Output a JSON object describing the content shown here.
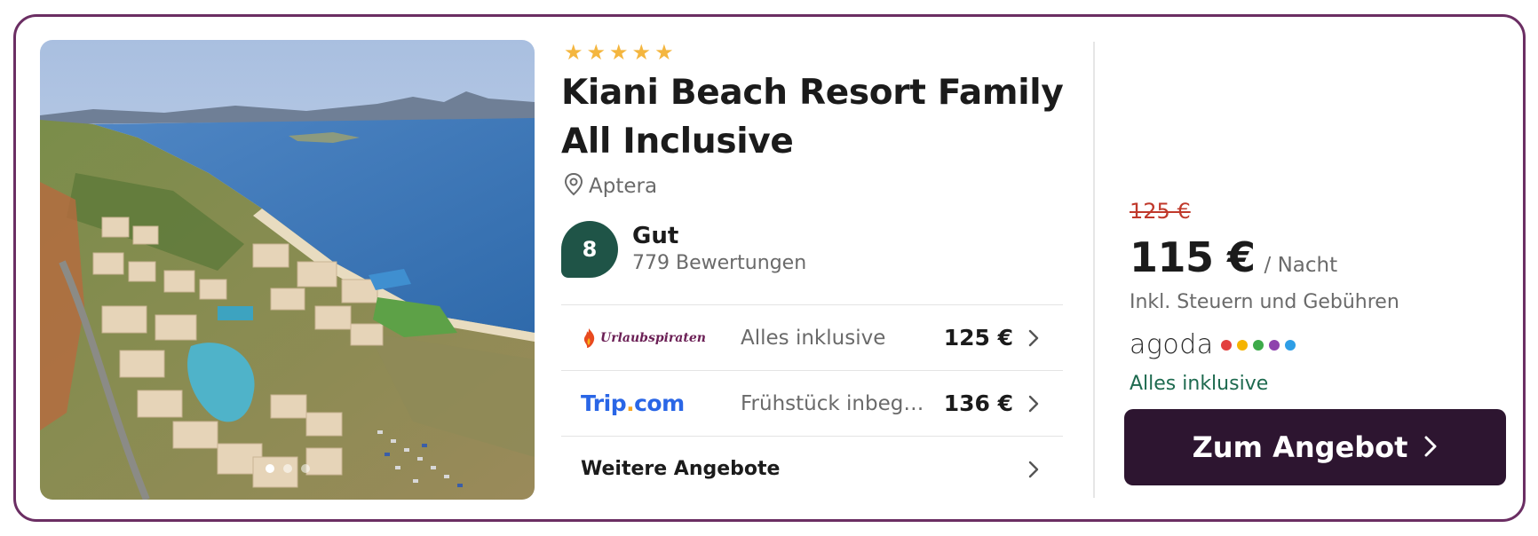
{
  "hotel": {
    "stars": 5,
    "name": "Kiani Beach Resort Family All Inclusive",
    "location": "Aptera",
    "rating": {
      "score": "8",
      "label": "Gut",
      "reviews": "779 Bewertungen"
    },
    "gallery": {
      "dot_count": 3,
      "active_index": 0
    }
  },
  "offers": [
    {
      "provider": "Urlaubspiraten",
      "description": "Alles inklusive",
      "price": "125 €"
    },
    {
      "provider": "Trip.com",
      "description": "Frühstück inbegr...",
      "price": "136 €"
    }
  ],
  "more_offers": {
    "label": "Weitere Angebote"
  },
  "deal": {
    "old_price": "125 €",
    "price": "115 €",
    "per_night": "/ Nacht",
    "taxes_note": "Inkl. Steuern und Gebühren",
    "provider": "agoda",
    "provider_dot_colors": [
      "#e2403f",
      "#f5b400",
      "#3daa4a",
      "#8e44ad",
      "#2e9ee6"
    ],
    "board": "Alles inklusive",
    "cta_label": "Zum Angebot"
  },
  "colors": {
    "border": "#6b2e63",
    "rating_badge": "#1f5447",
    "star": "#f4b63f",
    "old_price": "#c0392b",
    "board": "#1e6a4f",
    "cta_bg": "#2d1530",
    "tripcom_blue": "#2a66e6"
  },
  "icons": {
    "location": "map-pin-icon",
    "chevron": "chevron-right-icon",
    "star": "star-icon"
  }
}
